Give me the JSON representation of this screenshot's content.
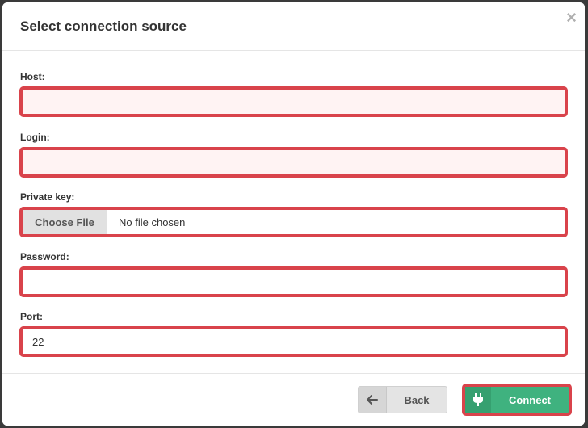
{
  "dialog": {
    "title": "Select connection source",
    "close_glyph": "×"
  },
  "form": {
    "host": {
      "label": "Host:",
      "value": "",
      "placeholder": ""
    },
    "login": {
      "label": "Login:",
      "value": "",
      "placeholder": ""
    },
    "private_key": {
      "label": "Private key:",
      "button_label": "Choose File",
      "status": "No file chosen"
    },
    "password": {
      "label": "Password:",
      "value": "",
      "placeholder": ""
    },
    "port": {
      "label": "Port:",
      "value": "22"
    }
  },
  "footer": {
    "back_label": "Back",
    "connect_label": "Connect"
  },
  "icons": {
    "close": "close-icon",
    "back": "arrow-left-icon",
    "connect": "plug-icon"
  },
  "colors": {
    "error_border": "#d9434b",
    "connect_bg": "#3fb27f",
    "error_fill": "#fff3f3"
  }
}
